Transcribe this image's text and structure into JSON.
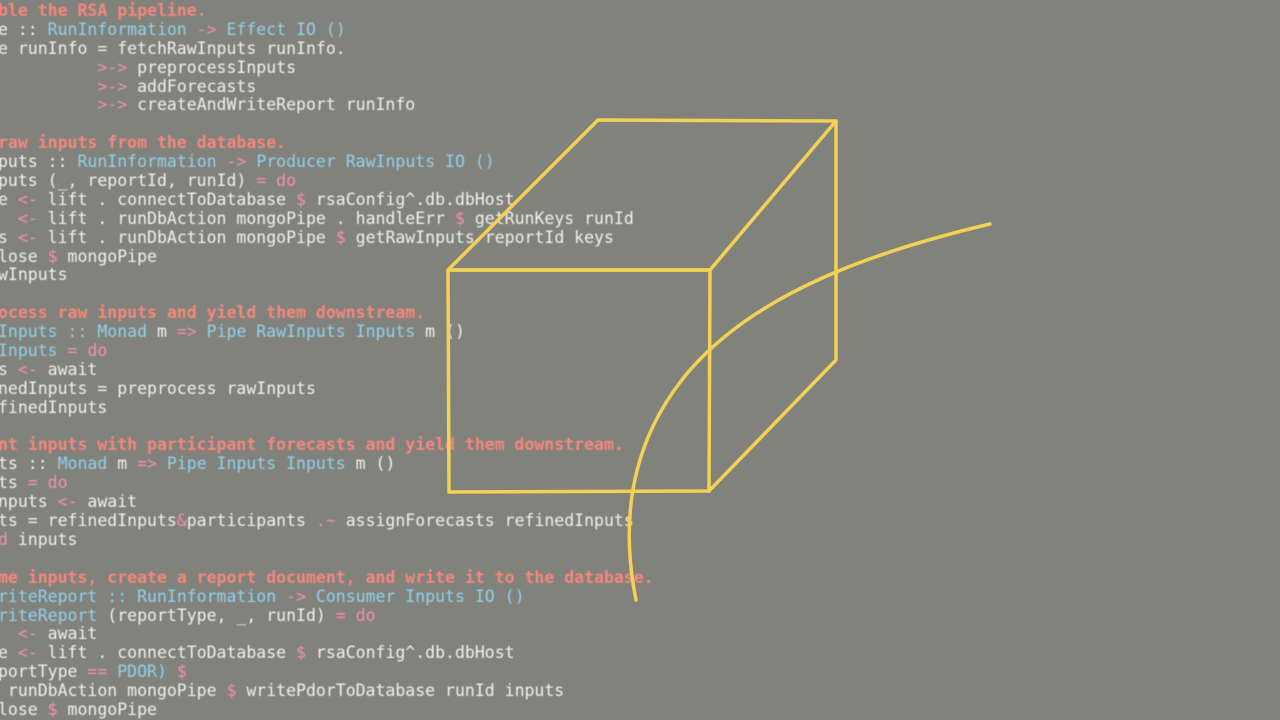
{
  "colors": {
    "background": "#82827c",
    "text": "#f2f2ec",
    "comment": "#f5877c",
    "type": "#8fd2ee",
    "keyword": "#f48fb1",
    "sketch": "#f3d155"
  },
  "code_lines": [
    [
      {
        "t": "ble the RSA pipeline.",
        "c": "comment"
      }
    ],
    [
      {
        "t": "e :: ",
        "c": "plain"
      },
      {
        "t": "RunInformation",
        "c": "type"
      },
      {
        "t": " -> ",
        "c": "op"
      },
      {
        "t": "Effect IO ()",
        "c": "type"
      }
    ],
    [
      {
        "t": "e runInfo = fetchRawInputs runInfo.",
        "c": "plain"
      }
    ],
    [
      {
        "t": "          ",
        "c": "plain"
      },
      {
        "t": ">->",
        "c": "op"
      },
      {
        "t": " preprocessInputs",
        "c": "plain"
      }
    ],
    [
      {
        "t": "          ",
        "c": "plain"
      },
      {
        "t": ">->",
        "c": "op"
      },
      {
        "t": " addForecasts",
        "c": "plain"
      }
    ],
    [
      {
        "t": "          ",
        "c": "plain"
      },
      {
        "t": ">->",
        "c": "op"
      },
      {
        "t": " createAndWriteReport runInfo",
        "c": "plain"
      }
    ],
    [
      {
        "t": "",
        "c": "plain"
      }
    ],
    [
      {
        "t": "raw inputs from the database.",
        "c": "comment"
      }
    ],
    [
      {
        "t": "puts :: ",
        "c": "plain"
      },
      {
        "t": "RunInformation",
        "c": "type"
      },
      {
        "t": " -> ",
        "c": "op"
      },
      {
        "t": "Producer RawInputs IO ()",
        "c": "type"
      }
    ],
    [
      {
        "t": "puts (_, reportId, runId) ",
        "c": "plain"
      },
      {
        "t": "= do",
        "c": "kw"
      }
    ],
    [
      {
        "t": "e ",
        "c": "plain"
      },
      {
        "t": "<-",
        "c": "op"
      },
      {
        "t": " lift . connectToDatabase ",
        "c": "plain"
      },
      {
        "t": "$",
        "c": "op"
      },
      {
        "t": " rsaConfig^.db.dbHost",
        "c": "plain"
      }
    ],
    [
      {
        "t": "  ",
        "c": "plain"
      },
      {
        "t": "<-",
        "c": "op"
      },
      {
        "t": " lift . runDbAction mongoPipe . handleErr ",
        "c": "plain"
      },
      {
        "t": "$",
        "c": "op"
      },
      {
        "t": " getRunKeys runId",
        "c": "plain"
      }
    ],
    [
      {
        "t": "s ",
        "c": "plain"
      },
      {
        "t": "<-",
        "c": "op"
      },
      {
        "t": " lift . runDbAction mongoPipe ",
        "c": "plain"
      },
      {
        "t": "$",
        "c": "op"
      },
      {
        "t": " getRawInputs reportId keys",
        "c": "plain"
      }
    ],
    [
      {
        "t": "lose ",
        "c": "plain"
      },
      {
        "t": "$",
        "c": "op"
      },
      {
        "t": " mongoPipe",
        "c": "plain"
      }
    ],
    [
      {
        "t": "wInputs",
        "c": "plain"
      }
    ],
    [
      {
        "t": "",
        "c": "plain"
      }
    ],
    [
      {
        "t": "ocess raw inputs and yield them downstream.",
        "c": "comment"
      }
    ],
    [
      {
        "t": "Inputs :: ",
        "c": "type"
      },
      {
        "t": "Monad",
        "c": "type"
      },
      {
        "t": " m ",
        "c": "plain"
      },
      {
        "t": "=>",
        "c": "op"
      },
      {
        "t": " Pipe RawInputs Inputs",
        "c": "type"
      },
      {
        "t": " m ()",
        "c": "plain"
      }
    ],
    [
      {
        "t": "Inputs ",
        "c": "type"
      },
      {
        "t": "= do",
        "c": "kw"
      }
    ],
    [
      {
        "t": "s ",
        "c": "plain"
      },
      {
        "t": "<-",
        "c": "op"
      },
      {
        "t": " await",
        "c": "plain"
      }
    ],
    [
      {
        "t": "nedInputs = preprocess rawInputs",
        "c": "plain"
      }
    ],
    [
      {
        "t": "finedInputs",
        "c": "plain"
      }
    ],
    [
      {
        "t": "",
        "c": "plain"
      }
    ],
    [
      {
        "t": "nt inputs with participant forecasts and yield them downstream.",
        "c": "comment"
      }
    ],
    [
      {
        "t": "ts :: ",
        "c": "plain"
      },
      {
        "t": "Monad",
        "c": "type"
      },
      {
        "t": " m ",
        "c": "plain"
      },
      {
        "t": "=>",
        "c": "op"
      },
      {
        "t": " Pipe Inputs Inputs",
        "c": "type"
      },
      {
        "t": " m ()",
        "c": "plain"
      }
    ],
    [
      {
        "t": "ts ",
        "c": "plain"
      },
      {
        "t": "= do",
        "c": "kw"
      }
    ],
    [
      {
        "t": "nputs ",
        "c": "plain"
      },
      {
        "t": "<-",
        "c": "op"
      },
      {
        "t": " await",
        "c": "plain"
      }
    ],
    [
      {
        "t": "ts = refinedInputs",
        "c": "plain"
      },
      {
        "t": "&",
        "c": "op"
      },
      {
        "t": "participants ",
        "c": "plain"
      },
      {
        "t": ".~",
        "c": "op"
      },
      {
        "t": " assignForecasts refinedInputs",
        "c": "plain"
      }
    ],
    [
      {
        "t": "d",
        "c": "kw"
      },
      {
        "t": " inputs",
        "c": "plain"
      }
    ],
    [
      {
        "t": "",
        "c": "plain"
      }
    ],
    [
      {
        "t": "me inputs, create a report document, and write it to the database.",
        "c": "comment"
      }
    ],
    [
      {
        "t": "riteReport :: ",
        "c": "type"
      },
      {
        "t": "RunInformation",
        "c": "type"
      },
      {
        "t": " -> ",
        "c": "op"
      },
      {
        "t": "Consumer Inputs IO ()",
        "c": "type"
      }
    ],
    [
      {
        "t": "riteReport ",
        "c": "type"
      },
      {
        "t": "(reportType, _, runId) ",
        "c": "plain"
      },
      {
        "t": "= do",
        "c": "kw"
      }
    ],
    [
      {
        "t": "  ",
        "c": "plain"
      },
      {
        "t": "<-",
        "c": "op"
      },
      {
        "t": " await",
        "c": "plain"
      }
    ],
    [
      {
        "t": "e ",
        "c": "plain"
      },
      {
        "t": "<-",
        "c": "op"
      },
      {
        "t": " lift . connectToDatabase ",
        "c": "plain"
      },
      {
        "t": "$",
        "c": "op"
      },
      {
        "t": " rsaConfig^.db.dbHost",
        "c": "plain"
      }
    ],
    [
      {
        "t": "portType ",
        "c": "plain"
      },
      {
        "t": "==",
        "c": "op"
      },
      {
        "t": " PDOR) ",
        "c": "type"
      },
      {
        "t": "$",
        "c": "op"
      }
    ],
    [
      {
        "t": " runDbAction mongoPipe ",
        "c": "plain"
      },
      {
        "t": "$",
        "c": "op"
      },
      {
        "t": " writePdorToDatabase runId inputs",
        "c": "plain"
      }
    ],
    [
      {
        "t": "lose ",
        "c": "plain"
      },
      {
        "t": "$",
        "c": "op"
      },
      {
        "t": " mongoPipe",
        "c": "plain"
      }
    ]
  ]
}
